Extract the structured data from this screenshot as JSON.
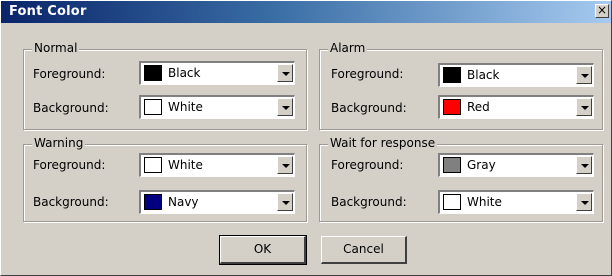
{
  "dialog": {
    "title": "Font Color",
    "close_glyph": "×"
  },
  "groups": {
    "normal": {
      "title": "Normal",
      "foreground": {
        "label": "Foreground:",
        "value": "Black",
        "color": "#000000"
      },
      "background": {
        "label": "Background:",
        "value": "White",
        "color": "#ffffff"
      }
    },
    "alarm": {
      "title": "Alarm",
      "foreground": {
        "label": "Foreground:",
        "value": "Black",
        "color": "#000000"
      },
      "background": {
        "label": "Background:",
        "value": "Red",
        "color": "#ff0000"
      }
    },
    "warning": {
      "title": "Warning",
      "foreground": {
        "label": "Foreground:",
        "value": "White",
        "color": "#ffffff"
      },
      "background": {
        "label": "Background:",
        "value": "Navy",
        "color": "#000080"
      }
    },
    "wait": {
      "title": "Wait for response",
      "foreground": {
        "label": "Foreground:",
        "value": "Gray",
        "color": "#808080"
      },
      "background": {
        "label": "Background:",
        "value": "White",
        "color": "#ffffff"
      }
    }
  },
  "buttons": {
    "ok": "OK",
    "cancel": "Cancel"
  }
}
